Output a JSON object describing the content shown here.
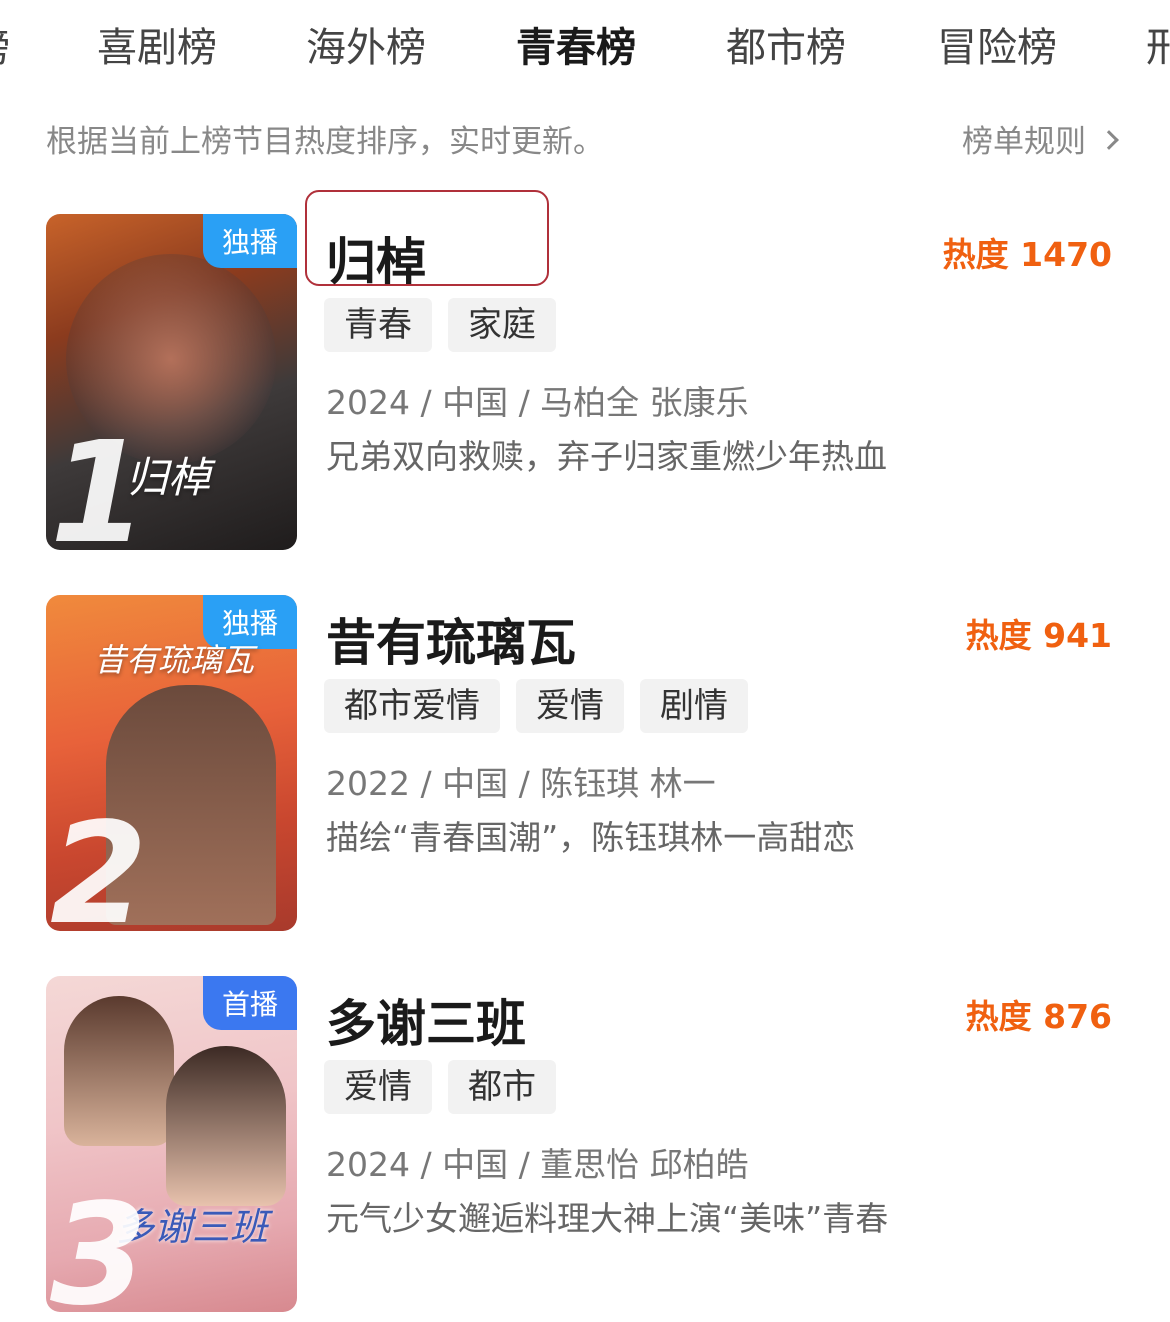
{
  "tabs": [
    {
      "label": "榜"
    },
    {
      "label": "喜剧榜"
    },
    {
      "label": "海外榜"
    },
    {
      "label": "青春榜"
    },
    {
      "label": "都市榜"
    },
    {
      "label": "冒险榜"
    },
    {
      "label": "刑"
    }
  ],
  "active_tab": "青春榜",
  "subheader": {
    "description": "根据当前上榜节目热度排序，实时更新。",
    "rules_link": "榜单规则"
  },
  "items": [
    {
      "rank": "1",
      "badge": "独播",
      "badge_color": "#2aa0f5",
      "poster_text": "归棹",
      "title": "归棹",
      "heat": "热度 1470",
      "tags": [
        "青春",
        "家庭"
      ],
      "meta": "2024 / 中国 / 马柏全 张康乐",
      "summary": "兄弟双向救赎，弃子归家重燃少年热血"
    },
    {
      "rank": "2",
      "badge": "独播",
      "badge_color": "#2aa0f5",
      "poster_text": "昔有琉璃瓦",
      "title": "昔有琉璃瓦",
      "heat": "热度 941",
      "tags": [
        "都市爱情",
        "爱情",
        "剧情"
      ],
      "meta": "2022 / 中国 / 陈钰琪 林一",
      "summary": "描绘“青春国潮”，陈钰琪林一高甜恋"
    },
    {
      "rank": "3",
      "badge": "首播",
      "badge_color": "#3b78f0",
      "poster_text": "多谢三班",
      "title": "多谢三班",
      "heat": "热度 876",
      "tags": [
        "爱情",
        "都市"
      ],
      "meta": "2024 / 中国 / 董思怡 邱柏皓",
      "summary": "元气少女邂逅料理大神上演“美味”青春"
    }
  ]
}
